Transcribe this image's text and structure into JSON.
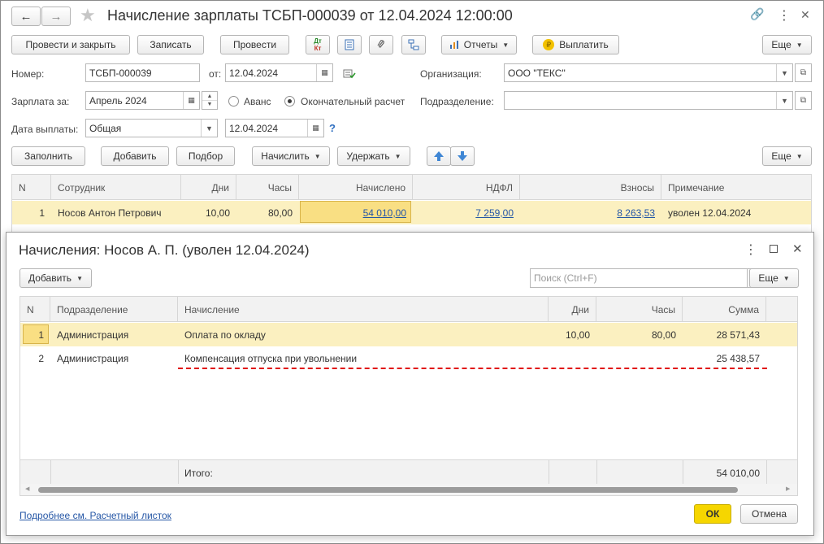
{
  "window": {
    "title": "Начисление зарплаты ТСБП-000039 от 12.04.2024 12:00:00",
    "nav_back": "←",
    "nav_forward": "→",
    "star": "★",
    "link_icon": "🔗",
    "menu": "⋮",
    "close": "✕"
  },
  "toolbar": {
    "post_close": "Провести и закрыть",
    "save": "Записать",
    "post": "Провести",
    "dt_kt_top": "Дт",
    "dt_kt_bottom": "Кт",
    "reports": "Отчеты",
    "pay": "Выплатить",
    "more": "Еще"
  },
  "form": {
    "number_label": "Номер:",
    "number_value": "ТСБП-000039",
    "from_label": "от:",
    "date_value": "12.04.2024",
    "org_label": "Организация:",
    "org_value": "ООО \"ТЕКС\"",
    "salary_label": "Зарплата за:",
    "salary_value": "Апрель 2024",
    "advance_label": "Аванс",
    "final_label": "Окончательный расчет",
    "dept_label": "Подразделение:",
    "dept_value": "",
    "paydate_label": "Дата выплаты:",
    "paydate_kind": "Общая",
    "paydate_value": "12.04.2024",
    "help": "?"
  },
  "table_toolbar": {
    "fill": "Заполнить",
    "add": "Добавить",
    "select": "Подбор",
    "accrue": "Начислить",
    "withhold": "Удержать",
    "more": "Еще"
  },
  "main_table": {
    "headers": [
      "N",
      "Сотрудник",
      "Дни",
      "Часы",
      "Начислено",
      "НДФЛ",
      "Взносы",
      "Примечание"
    ],
    "rows": [
      {
        "n": "1",
        "employee": "Носов Антон Петрович",
        "days": "10,00",
        "hours": "80,00",
        "accrued": "54 010,00",
        "ndfl": "7 259,00",
        "contrib": "8 263,53",
        "note": "уволен 12.04.2024"
      }
    ]
  },
  "dialog": {
    "title": "Начисления: Носов А. П. (уволен 12.04.2024)",
    "add": "Добавить",
    "search_placeholder": "Поиск (Ctrl+F)",
    "clear": "×",
    "more": "Еще",
    "headers": [
      "N",
      "Подразделение",
      "Начисление",
      "Дни",
      "Часы",
      "Сумма"
    ],
    "rows": [
      {
        "n": "1",
        "dept": "Администрация",
        "accrual": "Оплата по окладу",
        "days": "10,00",
        "hours": "80,00",
        "sum": "28 571,43"
      },
      {
        "n": "2",
        "dept": "Администрация",
        "accrual": "Компенсация отпуска при увольнении",
        "days": "",
        "hours": "",
        "sum": "25 438,57"
      }
    ],
    "total_label": "Итого:",
    "total_sum": "54 010,00",
    "details_link": "Подробнее см. Расчетный листок",
    "ok": "ОК",
    "cancel": "Отмена"
  },
  "colors": {
    "highlight_row": "#fbf0c0",
    "selected_cell": "#f9df83",
    "ok_button": "#f6d600",
    "link": "#2657a6",
    "annotation": "#e01010"
  }
}
